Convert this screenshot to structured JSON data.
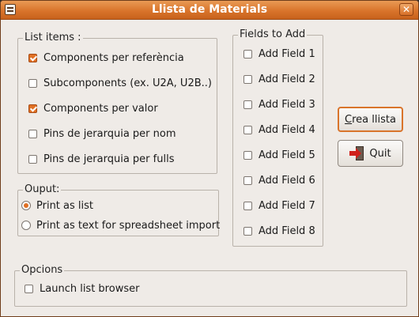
{
  "window": {
    "title": "Llista de Materials",
    "close_glyph": "✕",
    "icon": "list-document-icon"
  },
  "list_items": {
    "label": "List items :",
    "items": [
      {
        "label": "Components per referència",
        "checked": true
      },
      {
        "label": "Subcomponents (ex. U2A, U2B..)",
        "checked": false
      },
      {
        "label": "Components per valor",
        "checked": true
      },
      {
        "label": "Pins de jerarquia per nom",
        "checked": false
      },
      {
        "label": "Pins de jerarquia per fulls",
        "checked": false
      }
    ]
  },
  "output": {
    "label": "Ouput:",
    "options": [
      {
        "label": "Print as list",
        "selected": true
      },
      {
        "label": "Print as text for spreadsheet import",
        "selected": false
      }
    ]
  },
  "fields": {
    "label": "Fields to Add",
    "items": [
      {
        "label": "Add Field 1",
        "checked": false
      },
      {
        "label": "Add Field 2",
        "checked": false
      },
      {
        "label": "Add Field 3",
        "checked": false
      },
      {
        "label": "Add Field 4",
        "checked": false
      },
      {
        "label": "Add Field 5",
        "checked": false
      },
      {
        "label": "Add Field 6",
        "checked": false
      },
      {
        "label": "Add Field 7",
        "checked": false
      },
      {
        "label": "Add Field 8",
        "checked": false
      }
    ]
  },
  "buttons": {
    "create_mnemonic": "C",
    "create_rest": "rea llista",
    "quit": "Quit",
    "quit_icon": "exit-door-icon"
  },
  "options": {
    "label": "Opcions",
    "launch_browser": {
      "label": "Launch list browser",
      "checked": false
    }
  },
  "colors": {
    "titlebar": "#d9742b",
    "accent": "#e07024",
    "window_bg": "#efebe7"
  }
}
